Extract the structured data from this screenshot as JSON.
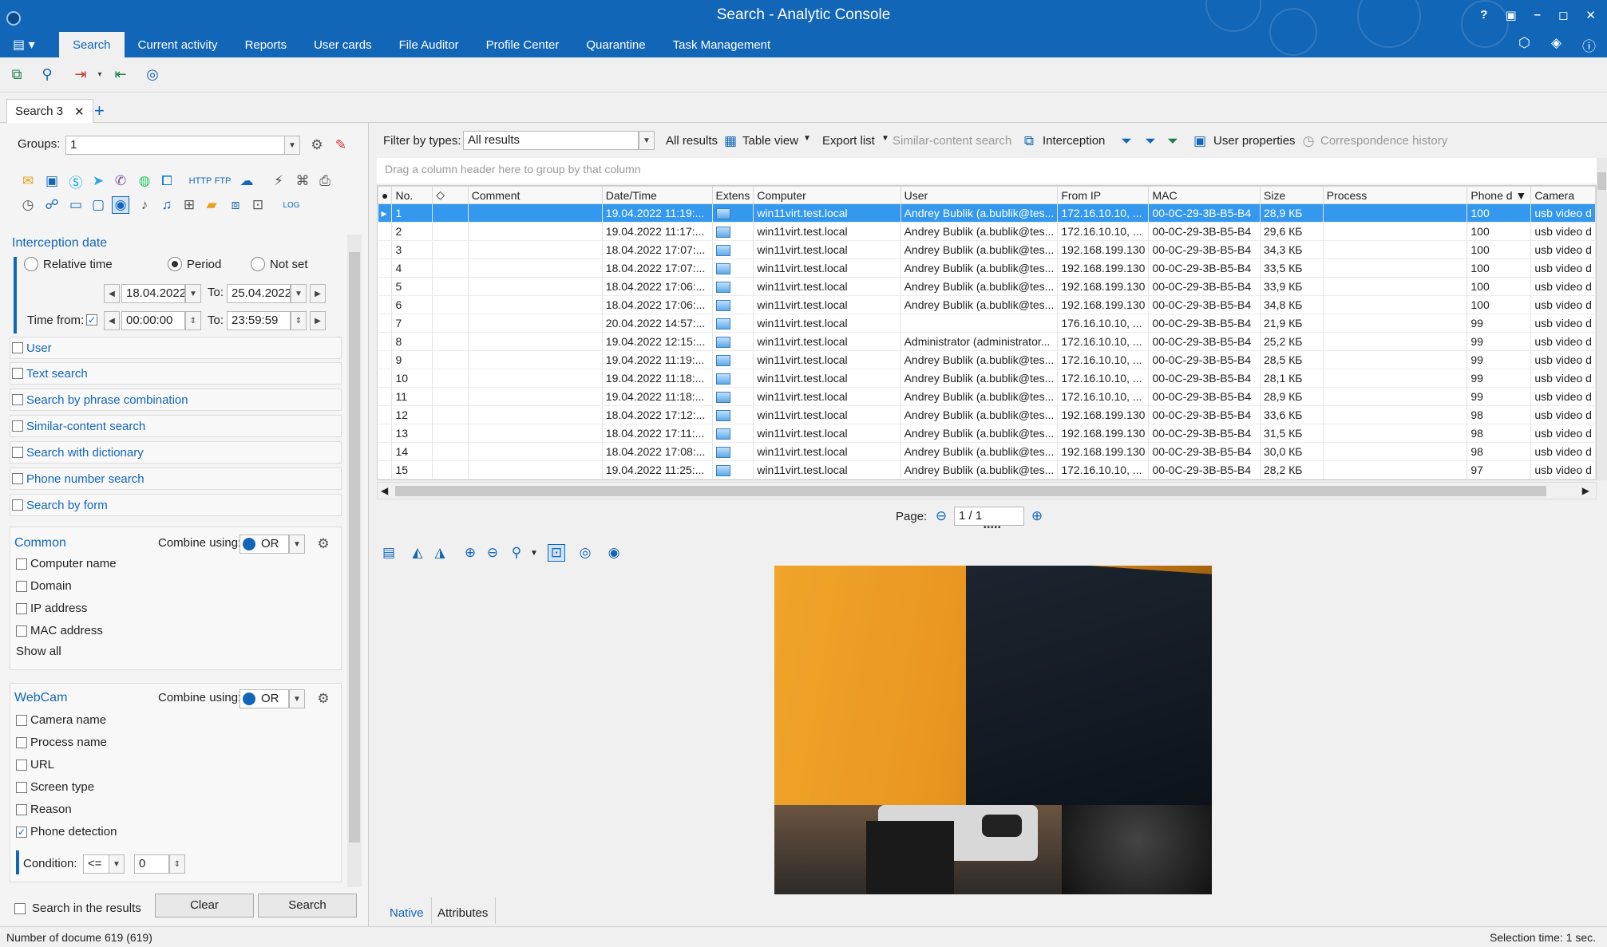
{
  "window": {
    "title": "Search - Analytic Console",
    "controls": [
      "?",
      "▣",
      "–",
      "◻",
      "✕"
    ]
  },
  "menu": {
    "tabs": [
      "Search",
      "Current activity",
      "Reports",
      "User cards",
      "File Auditor",
      "Profile Center",
      "Quarantine",
      "Task Management"
    ],
    "active": "Search"
  },
  "doc_tab": {
    "label": "Search 3",
    "close": "✕",
    "add": "+"
  },
  "left": {
    "groups_label": "Groups:",
    "groups_value": "1",
    "interception_date": "Interception date",
    "relative_time": "Relative time",
    "period": "Period",
    "not_set": "Not set",
    "date_from": "18.04.2022",
    "to_label": "To:",
    "date_to": "25.04.2022",
    "time_from_label": "Time from:",
    "time_from": "00:00:00",
    "time_to": "23:59:59",
    "sections": [
      "User",
      "Text search",
      "Search by phrase combination",
      "Similar-content search",
      "Search with dictionary",
      "Phone number search",
      "Search by form"
    ],
    "common": {
      "title": "Common",
      "combine_label": "Combine using:",
      "combine_value": "OR",
      "items": [
        "Computer name",
        "Domain",
        "IP address",
        "MAC address"
      ],
      "show_all": "Show all"
    },
    "webcam": {
      "title": "WebCam",
      "combine_label": "Combine using:",
      "combine_value": "OR",
      "items": [
        "Camera name",
        "Process name",
        "URL",
        "Screen type",
        "Reason",
        "Phone detection"
      ],
      "checked": "Phone detection",
      "condition_label": "Condition:",
      "condition_op": "<=",
      "condition_value": "0"
    },
    "search_in_results": "Search in the results",
    "clear_button": "Clear",
    "search_button": "Search"
  },
  "filterbar": {
    "filter_label": "Filter by types:",
    "filter_value": "All results",
    "all_results": "All results",
    "table_view": "Table view",
    "export_list": "Export list",
    "similar_content": "Similar-content search",
    "interception": "Interception",
    "user_properties": "User properties",
    "correspondence_history": "Correspondence history"
  },
  "groupby_hint": "Drag a column header here to group by that column",
  "grid": {
    "columns": [
      "No.",
      "",
      "Comment",
      "Date/Time",
      "Extens",
      "Computer",
      "User",
      "From IP",
      "MAC",
      "Size",
      "Process",
      "Phone d",
      "Camera"
    ],
    "rows": [
      [
        "1",
        "19.04.2022 11:19:...",
        "win11virt.test.local",
        "Andrey Bublik (a.bublik@tes...",
        "172.16.10.10,  ...",
        "00-0C-29-3B-B5-B4",
        "28,9 КБ",
        "100",
        "usb video d"
      ],
      [
        "2",
        "19.04.2022 11:17:...",
        "win11virt.test.local",
        "Andrey Bublik (a.bublik@tes...",
        "172.16.10.10,  ...",
        "00-0C-29-3B-B5-B4",
        "29,6 КБ",
        "100",
        "usb video d"
      ],
      [
        "3",
        "18.04.2022 17:07:...",
        "win11virt.test.local",
        "Andrey Bublik (a.bublik@tes...",
        "192.168.199.130",
        "00-0C-29-3B-B5-B4",
        "34,3 КБ",
        "100",
        "usb video d"
      ],
      [
        "4",
        "18.04.2022 17:07:...",
        "win11virt.test.local",
        "Andrey Bublik (a.bublik@tes...",
        "192.168.199.130",
        "00-0C-29-3B-B5-B4",
        "33,5 КБ",
        "100",
        "usb video d"
      ],
      [
        "5",
        "18.04.2022 17:06:...",
        "win11virt.test.local",
        "Andrey Bublik (a.bublik@tes...",
        "192.168.199.130",
        "00-0C-29-3B-B5-B4",
        "33,9 КБ",
        "100",
        "usb video d"
      ],
      [
        "6",
        "18.04.2022 17:06:...",
        "win11virt.test.local",
        "Andrey Bublik (a.bublik@tes...",
        "192.168.199.130",
        "00-0C-29-3B-B5-B4",
        "34,8 КБ",
        "100",
        "usb video d"
      ],
      [
        "7",
        "20.04.2022 14:57:...",
        "win11virt.test.local",
        "",
        "176.16.10.10,  ...",
        "00-0C-29-3B-B5-B4",
        "21,9 КБ",
        "99",
        "usb video d"
      ],
      [
        "8",
        "19.04.2022 12:15:...",
        "win11virt.test.local",
        "Administrator (administrator...",
        "172.16.10.10,  ...",
        "00-0C-29-3B-B5-B4",
        "25,2 КБ",
        "99",
        "usb video d"
      ],
      [
        "9",
        "19.04.2022 11:19:...",
        "win11virt.test.local",
        "Andrey Bublik (a.bublik@tes...",
        "172.16.10.10,  ...",
        "00-0C-29-3B-B5-B4",
        "28,5 КБ",
        "99",
        "usb video d"
      ],
      [
        "10",
        "19.04.2022 11:18:...",
        "win11virt.test.local",
        "Andrey Bublik (a.bublik@tes...",
        "172.16.10.10,  ...",
        "00-0C-29-3B-B5-B4",
        "28,1 КБ",
        "99",
        "usb video d"
      ],
      [
        "11",
        "19.04.2022 11:18:...",
        "win11virt.test.local",
        "Andrey Bublik (a.bublik@tes...",
        "172.16.10.10,  ...",
        "00-0C-29-3B-B5-B4",
        "28,9 КБ",
        "99",
        "usb video d"
      ],
      [
        "12",
        "18.04.2022 17:12:...",
        "win11virt.test.local",
        "Andrey Bublik (a.bublik@tes...",
        "192.168.199.130",
        "00-0C-29-3B-B5-B4",
        "33,6 КБ",
        "98",
        "usb video d"
      ],
      [
        "13",
        "18.04.2022 17:11:...",
        "win11virt.test.local",
        "Andrey Bublik (a.bublik@tes...",
        "192.168.199.130",
        "00-0C-29-3B-B5-B4",
        "31,5 КБ",
        "98",
        "usb video d"
      ],
      [
        "14",
        "18.04.2022 17:08:...",
        "win11virt.test.local",
        "Andrey Bublik (a.bublik@tes...",
        "192.168.199.130",
        "00-0C-29-3B-B5-B4",
        "30,0 КБ",
        "98",
        "usb video d"
      ],
      [
        "15",
        "19.04.2022 11:25:...",
        "win11virt.test.local",
        "Andrey Bublik (a.bublik@tes...",
        "172.16.10.10,  ...",
        "00-0C-29-3B-B5-B4",
        "28,2 КБ",
        "97",
        "usb video d"
      ]
    ]
  },
  "pager": {
    "label": "Page:",
    "value": "1 / 1"
  },
  "viewer_tabs": [
    "Native",
    "Attributes"
  ],
  "status": {
    "left": "Number of docume 619 (619)",
    "right": "Selection time: 1 sec."
  },
  "colors": {
    "accent": "#1266b8",
    "selected_row": "#3398ee"
  }
}
